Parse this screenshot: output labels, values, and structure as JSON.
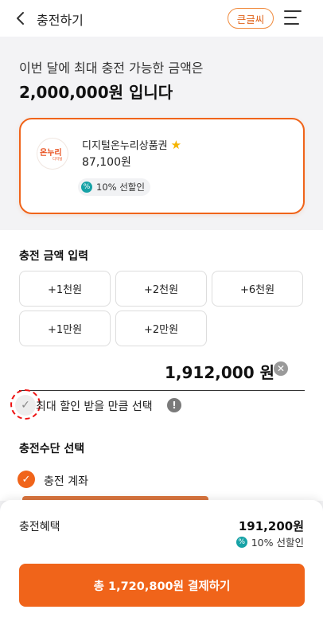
{
  "header": {
    "title": "충전하기",
    "font_size_button": "큰글씨"
  },
  "limit": {
    "line1": "이번 달에 최대 충전 가능한 금액은",
    "amount": "2,000,000원",
    "suffix": " 입니다"
  },
  "gift_card": {
    "logo_text": "온누리",
    "logo_subtext": "디지털",
    "name": "디지털온누리상품권",
    "starred": true,
    "balance": "87,100원",
    "discount_badge": "10% 선할인"
  },
  "charge": {
    "section_title": "충전 금액 입력",
    "amount_buttons": [
      "+1천원",
      "+2천원",
      "+6천원",
      "+1만원",
      "+2만원"
    ],
    "amount_value": "1,912,000",
    "amount_unit": "원",
    "max_discount_label": "최대 할인 받을 만큼 선택",
    "max_discount_checked": false
  },
  "method": {
    "section_title": "충전수단 선택",
    "selected": "충전 계좌"
  },
  "summary": {
    "benefit_label": "충전혜택",
    "benefit_amount": "191,200원",
    "benefit_badge": "10% 선할인",
    "pay_button": "총 1,720,800원 결제하기"
  },
  "colors": {
    "accent": "#f0641a",
    "teal": "#16a2a6",
    "highlight": "#fbd3b6"
  }
}
